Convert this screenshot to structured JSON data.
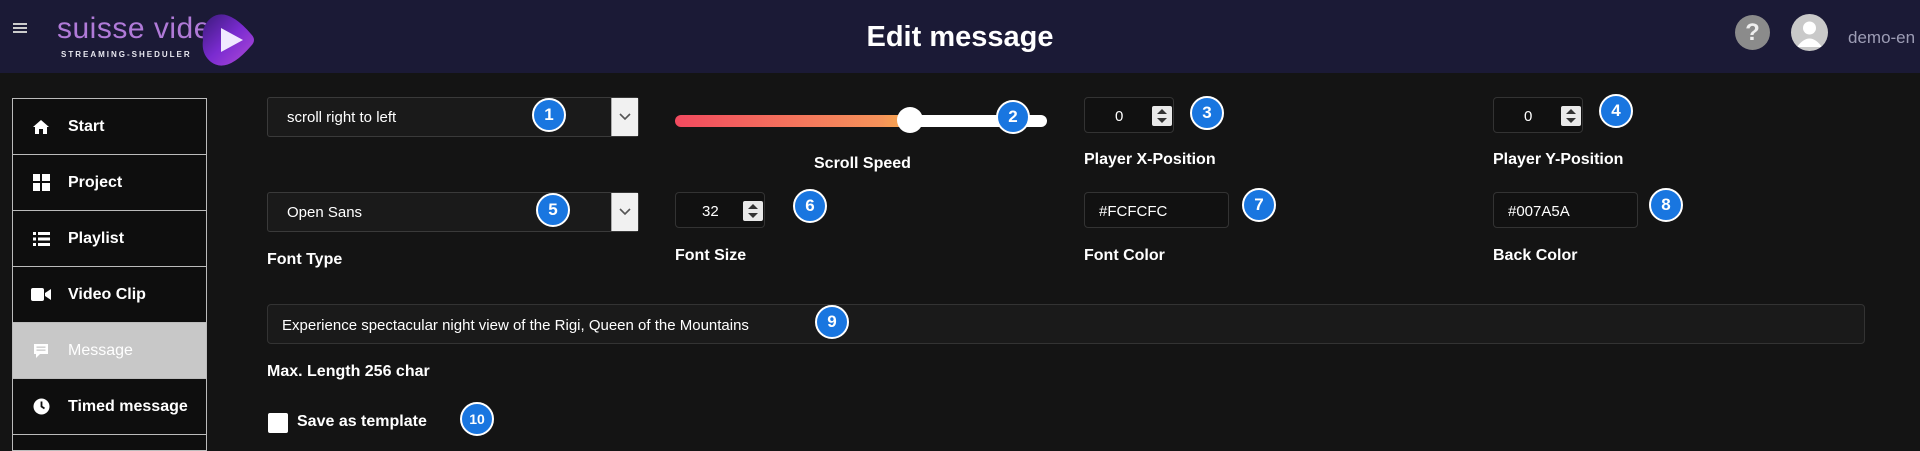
{
  "header": {
    "brand_name": "suisse video",
    "brand_sub": "STREAMING-SHEDULER",
    "title": "Edit message",
    "help_label": "?",
    "user_name": "demo-en"
  },
  "sidebar": {
    "items": [
      {
        "label": "Start",
        "icon": "home-icon"
      },
      {
        "label": "Project",
        "icon": "grid-icon"
      },
      {
        "label": "Playlist",
        "icon": "list-icon"
      },
      {
        "label": "Video Clip",
        "icon": "video-camera-icon"
      },
      {
        "label": "Message",
        "icon": "message-icon",
        "active": true
      },
      {
        "label": "Timed message",
        "icon": "clock-icon"
      }
    ]
  },
  "form": {
    "scroll_mode": {
      "value": "scroll right to left",
      "badge": "1"
    },
    "scroll_speed": {
      "label": "Scroll Speed",
      "badge": "2",
      "level": 0.63
    },
    "player_x": {
      "label": "Player X-Position",
      "value": "0",
      "badge": "3"
    },
    "player_y": {
      "label": "Player Y-Position",
      "value": "0",
      "badge": "4"
    },
    "font_type": {
      "label": "Font Type",
      "value": "Open Sans",
      "badge": "5"
    },
    "font_size": {
      "label": "Font Size",
      "value": "32",
      "badge": "6"
    },
    "font_color": {
      "label": "Font Color",
      "value": "#FCFCFC",
      "badge": "7"
    },
    "back_color": {
      "label": "Back Color",
      "value": "#007A5A",
      "badge": "8"
    },
    "message_text": {
      "value": "Experience spectacular night view of the Rigi, Queen of the Mountains",
      "badge": "9"
    },
    "max_length": "Max. Length 256 char",
    "save_template": {
      "label": "Save as template",
      "badge": "10",
      "checked": false
    }
  },
  "colors": {
    "header_bg": "#1b1a36",
    "page_bg": "#141414",
    "badge": "#1976e0",
    "slider_start": "#f24a5f",
    "slider_end": "#f7a84f"
  }
}
